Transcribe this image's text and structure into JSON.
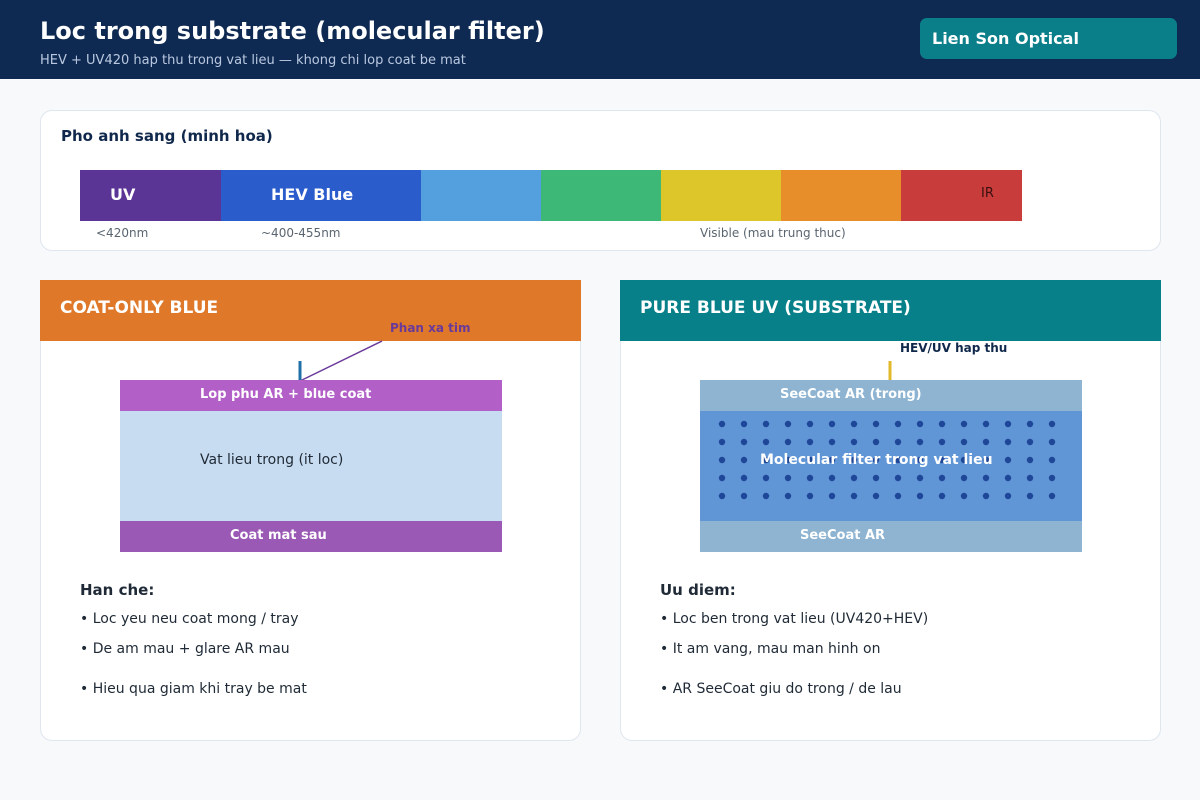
{
  "header": {
    "title": "Loc trong substrate (molecular filter)",
    "subtitle": "HEV + UV420 hap thu trong vat lieu — khong chi lop coat be mat",
    "brand": "Lien Son Optical"
  },
  "spectrum": {
    "title": "Pho anh sang (minh hoa)",
    "bands": [
      {
        "label": "UV",
        "color": "#5b3596"
      },
      {
        "label": "HEV Blue",
        "color": "#2b5ccc"
      },
      {
        "label": "",
        "color": "#54a0de"
      },
      {
        "label": "",
        "color": "#3db876"
      },
      {
        "label": "",
        "color": "#dcc62a"
      },
      {
        "label": "",
        "color": "#e78d2a"
      },
      {
        "label": "IR",
        "color": "#c93c3c"
      }
    ],
    "notes": [
      "<420nm",
      "~400-455nm",
      "Visible (mau trung thuc)"
    ]
  },
  "left_panel": {
    "header": "COAT-ONLY BLUE",
    "header_color": "#df7828",
    "annotation": "Phan xa tim",
    "top_coat": "Lop phu AR + blue coat",
    "core": "Vat lieu trong (it loc)",
    "bottom_coat": "Coat mat sau",
    "list_title": "Han che:",
    "items": [
      "• Loc yeu neu coat mong / tray",
      "• De am mau + glare AR mau",
      "• Hieu qua giam khi tray be mat"
    ]
  },
  "right_panel": {
    "header": "PURE BLUE UV (SUBSTRATE)",
    "header_color": "#07808a",
    "annotation": "HEV/UV hap thu",
    "top_coat": "SeeCoat AR (trong)",
    "core": "Molecular filter trong vat lieu",
    "bottom_coat": "SeeCoat AR",
    "list_title": "Uu diem:",
    "items": [
      "• Loc ben trong vat lieu (UV420+HEV)",
      "• It am vang, mau man hinh on",
      "• AR SeeCoat giu do trong / de lau"
    ]
  }
}
